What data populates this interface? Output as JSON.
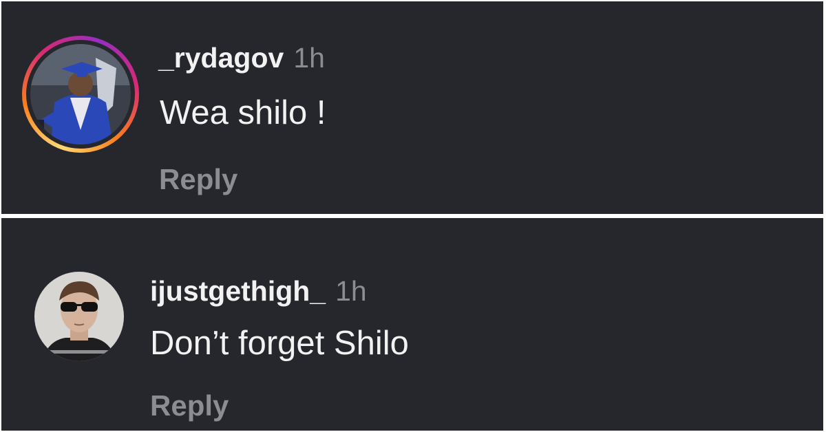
{
  "comments": [
    {
      "username": "_rydagov",
      "time": "1h",
      "text": "Wea shilo !",
      "reply_label": "Reply",
      "avatar_icon": "graduation-photo-avatar",
      "has_story_ring": true
    },
    {
      "username": "ijustgethigh_",
      "time": "1h",
      "text": "Don’t forget Shilo",
      "reply_label": "Reply",
      "avatar_icon": "sunglasses-portrait-avatar",
      "has_story_ring": false
    }
  ],
  "colors": {
    "background": "#25272d",
    "text_primary": "#f2f2f3",
    "text_secondary": "#8b8d92",
    "separator": "#ffffff"
  }
}
